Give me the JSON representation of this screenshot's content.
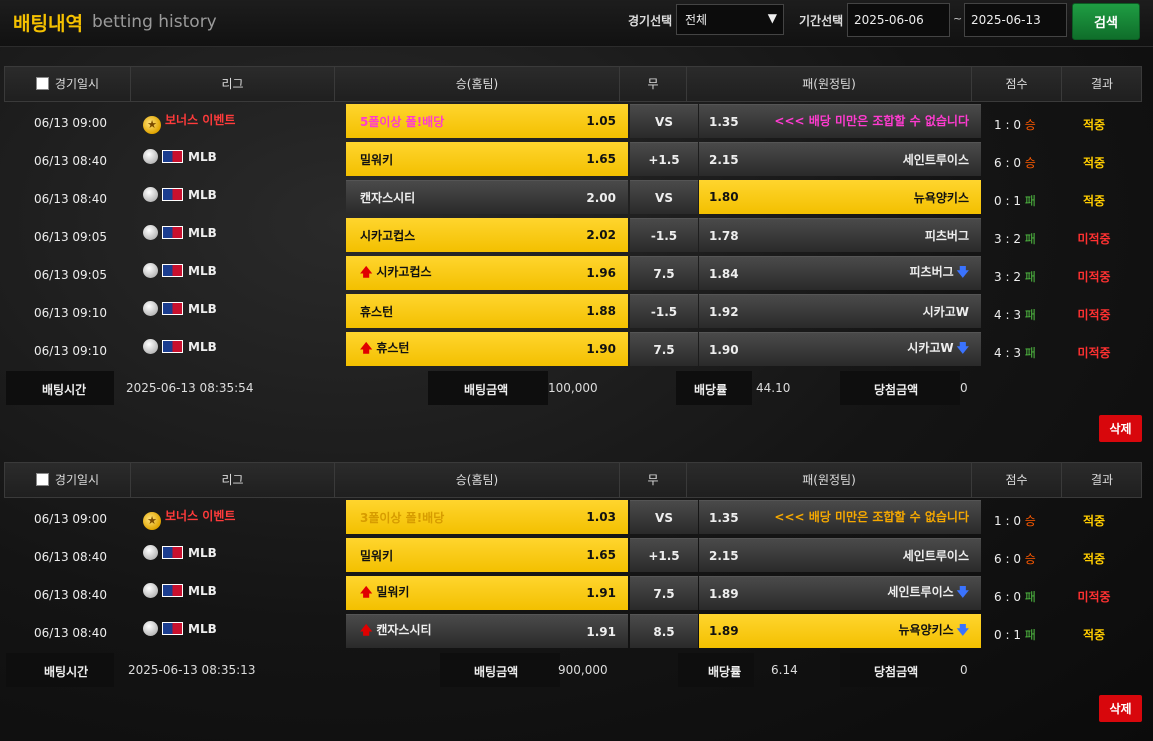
{
  "header": {
    "title_ko": "배팅내역",
    "title_en": "betting history",
    "game_select_label": "경기선택",
    "game_select_value": "전체",
    "period_label": "기간선택",
    "date_from": "2025-06-06",
    "date_to": "2025-06-13",
    "tilde": "~",
    "search_label": "검색"
  },
  "columns": {
    "date": "경기일시",
    "league": "리그",
    "home": "승(홈팀)",
    "draw": "무",
    "away": "패(원정팀)",
    "score": "점수",
    "result": "결과"
  },
  "labels": {
    "bet_time": "배팅시간",
    "bet_amount": "배팅금액",
    "odds": "배당률",
    "win_amount": "당첨금액",
    "delete": "삭제"
  },
  "bets": [
    {
      "rows": [
        {
          "time": "06/13 09:00",
          "league": "보너스 이벤트",
          "bonus": true,
          "home": "5폴이상 폴!배당",
          "home_odds": "1.05",
          "draw": "VS",
          "away_odds": "1.35",
          "away": "<<< 배당 미만은 조합할 수 없습니다",
          "home_sel": true,
          "away_sel": false,
          "score_h": "1",
          "score_a": "0",
          "outcome": "승",
          "result": "적중",
          "hit": true
        },
        {
          "time": "06/13 08:40",
          "league": "MLB",
          "home": "밀워키",
          "home_odds": "1.65",
          "draw": "+1.5",
          "away_odds": "2.15",
          "away": "세인트루이스",
          "home_sel": true,
          "away_sel": false,
          "score_h": "6",
          "score_a": "0",
          "outcome": "승",
          "result": "적중",
          "hit": true
        },
        {
          "time": "06/13 08:40",
          "league": "MLB",
          "home": "캔자스시티",
          "home_odds": "2.00",
          "draw": "VS",
          "away_odds": "1.80",
          "away": "뉴욕양키스",
          "home_sel": false,
          "away_sel": true,
          "score_h": "0",
          "score_a": "1",
          "outcome": "패",
          "result": "적중",
          "hit": true
        },
        {
          "time": "06/13 09:05",
          "league": "MLB",
          "home": "시카고컵스",
          "home_odds": "2.02",
          "draw": "-1.5",
          "away_odds": "1.78",
          "away": "피츠버그",
          "home_sel": true,
          "away_sel": false,
          "score_h": "3",
          "score_a": "2",
          "outcome": "패",
          "result": "미적중",
          "hit": false
        },
        {
          "time": "06/13 09:05",
          "league": "MLB",
          "home": "시카고컵스",
          "home_up": true,
          "home_odds": "1.96",
          "draw": "7.5",
          "away_odds": "1.84",
          "away": "피츠버그",
          "away_down": true,
          "home_sel": true,
          "away_sel": false,
          "score_h": "3",
          "score_a": "2",
          "outcome": "패",
          "result": "미적중",
          "hit": false
        },
        {
          "time": "06/13 09:10",
          "league": "MLB",
          "home": "휴스턴",
          "home_odds": "1.88",
          "draw": "-1.5",
          "away_odds": "1.92",
          "away": "시카고W",
          "home_sel": true,
          "away_sel": false,
          "score_h": "4",
          "score_a": "3",
          "outcome": "패",
          "result": "미적중",
          "hit": false
        },
        {
          "time": "06/13 09:10",
          "league": "MLB",
          "home": "휴스턴",
          "home_up": true,
          "home_odds": "1.90",
          "draw": "7.5",
          "away_odds": "1.90",
          "away": "시카고W",
          "away_down": true,
          "home_sel": true,
          "away_sel": false,
          "score_h": "4",
          "score_a": "3",
          "outcome": "패",
          "result": "미적중",
          "hit": false
        }
      ],
      "bet_time": "2025-06-13 08:35:54",
      "bet_amount": "100,000",
      "odds": "44.10",
      "win_amount": "0"
    },
    {
      "rows": [
        {
          "time": "06/13 09:00",
          "league": "보너스 이벤트",
          "bonus": true,
          "home": "3폴이상 폴!배당",
          "home_faded": true,
          "home_odds": "1.03",
          "draw": "VS",
          "away_odds": "1.35",
          "away": "<<< 배당 미만은 조합할 수 없습니다",
          "away_orange": true,
          "home_sel": true,
          "away_sel": false,
          "score_h": "1",
          "score_a": "0",
          "outcome": "승",
          "result": "적중",
          "hit": true
        },
        {
          "time": "06/13 08:40",
          "league": "MLB",
          "home": "밀워키",
          "home_odds": "1.65",
          "draw": "+1.5",
          "away_odds": "2.15",
          "away": "세인트루이스",
          "home_sel": true,
          "away_sel": false,
          "score_h": "6",
          "score_a": "0",
          "outcome": "승",
          "result": "적중",
          "hit": true
        },
        {
          "time": "06/13 08:40",
          "league": "MLB",
          "home": "밀워키",
          "home_up": true,
          "home_odds": "1.91",
          "draw": "7.5",
          "away_odds": "1.89",
          "away": "세인트루이스",
          "away_down": true,
          "home_sel": true,
          "away_sel": false,
          "score_h": "6",
          "score_a": "0",
          "outcome": "패",
          "result": "미적중",
          "hit": false
        },
        {
          "time": "06/13 08:40",
          "league": "MLB",
          "home": "캔자스시티",
          "home_up": true,
          "home_odds": "1.91",
          "draw": "8.5",
          "away_odds": "1.89",
          "away": "뉴욕양키스",
          "away_down": true,
          "home_sel": false,
          "away_sel": true,
          "score_h": "0",
          "score_a": "1",
          "outcome": "패",
          "result": "적중",
          "hit": true
        }
      ],
      "bet_time": "2025-06-13 08:35:13",
      "bet_amount": "900,000",
      "odds": "6.14",
      "win_amount": "0"
    }
  ]
}
